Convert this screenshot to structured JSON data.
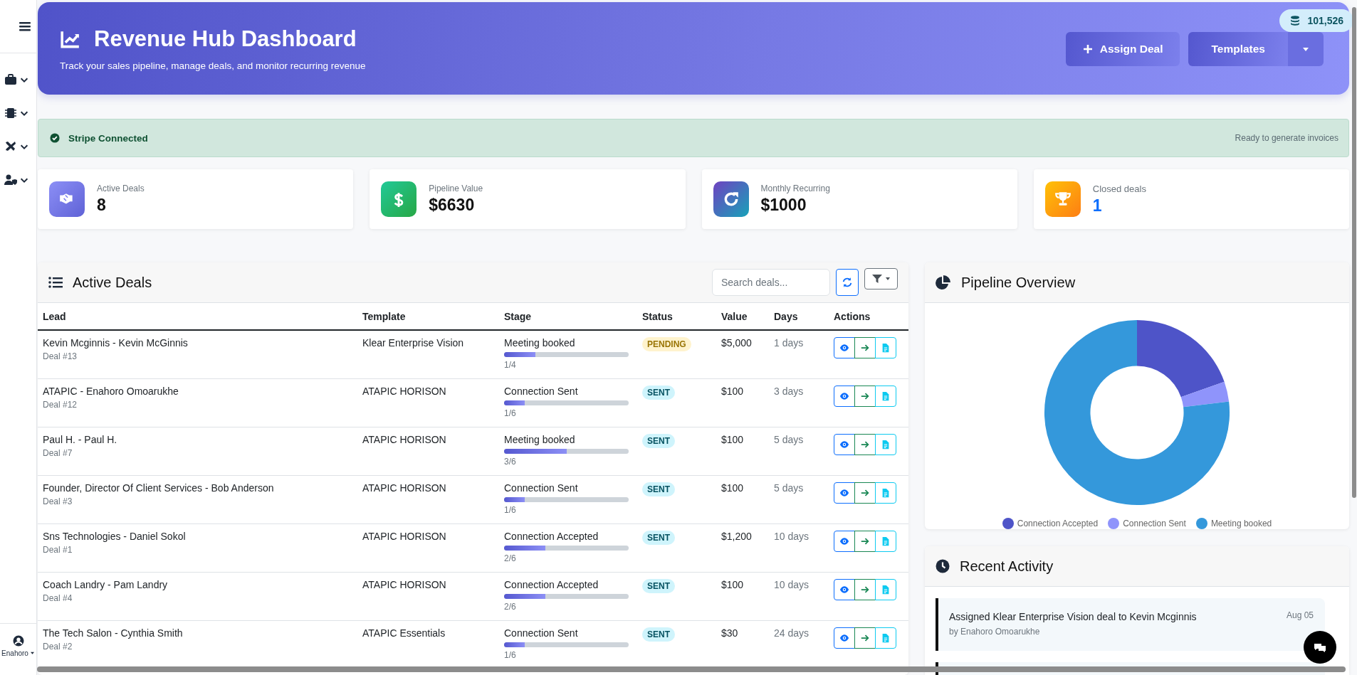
{
  "sidebar": {
    "user": "Enahoro"
  },
  "header": {
    "title": "Revenue Hub Dashboard",
    "subtitle": "Track your sales pipeline, manage deals, and monitor recurring revenue",
    "assign_button": "Assign Deal",
    "templates_button": "Templates",
    "credits": "101,526"
  },
  "alert": {
    "title": "Stripe Connected",
    "note": "Ready to generate invoices"
  },
  "stats": [
    {
      "kind": "deals",
      "label": "Active Deals",
      "value": "8"
    },
    {
      "kind": "pipeline",
      "label": "Pipeline Value",
      "value": "$6630"
    },
    {
      "kind": "recurring",
      "label": "Monthly Recurring",
      "value": "$1000"
    },
    {
      "kind": "closed",
      "label": "Closed deals",
      "value": "1"
    }
  ],
  "deals": {
    "title": "Active Deals",
    "search": {
      "placeholder": "Search deals..."
    },
    "columns": [
      "Lead",
      "Template",
      "Stage",
      "Status",
      "Value",
      "Days",
      "Actions"
    ],
    "rows": [
      {
        "lead": "Kevin Mcginnis - Kevin McGinnis",
        "deal": "Deal #13",
        "template": "Klear Enterprise Vision",
        "stage": "Meeting booked",
        "level": 0.25,
        "step": "1/4",
        "status": {
          "text": "PENDING",
          "kind": "pending"
        },
        "value": "$5,000",
        "days": "1 days"
      },
      {
        "lead": "ATAPIC - Enahoro Omoarukhe",
        "deal": "Deal #12",
        "template": "ATAPIC HORISON",
        "stage": "Connection Sent",
        "level": 0.167,
        "step": "1/6",
        "status": {
          "text": "SENT",
          "kind": "sent"
        },
        "value": "$100",
        "days": "3 days"
      },
      {
        "lead": "Paul H. - Paul H.",
        "deal": "Deal #7",
        "template": "ATAPIC HORISON",
        "stage": "Meeting booked",
        "level": 0.5,
        "step": "3/6",
        "status": {
          "text": "SENT",
          "kind": "sent"
        },
        "value": "$100",
        "days": "5 days"
      },
      {
        "lead": "Founder, Director Of Client Services - Bob Anderson",
        "deal": "Deal #3",
        "template": "ATAPIC HORISON",
        "stage": "Connection Sent",
        "level": 0.167,
        "step": "1/6",
        "status": {
          "text": "SENT",
          "kind": "sent"
        },
        "value": "$100",
        "days": "5 days"
      },
      {
        "lead": "Sns Technologies - Daniel Sokol",
        "deal": "Deal #1",
        "template": "ATAPIC HORISON",
        "stage": "Connection Accepted",
        "level": 0.333,
        "step": "2/6",
        "status": {
          "text": "SENT",
          "kind": "sent"
        },
        "value": "$1,200",
        "days": "10 days"
      },
      {
        "lead": "Coach Landry - Pam Landry",
        "deal": "Deal #4",
        "template": "ATAPIC HORISON",
        "stage": "Connection Accepted",
        "level": 0.333,
        "step": "2/6",
        "status": {
          "text": "SENT",
          "kind": "sent"
        },
        "value": "$100",
        "days": "10 days"
      },
      {
        "lead": "The Tech Salon - Cynthia Smith",
        "deal": "Deal #2",
        "template": "ATAPIC Essentials",
        "stage": "Connection Sent",
        "level": 0.167,
        "step": "1/6",
        "status": {
          "text": "SENT",
          "kind": "sent"
        },
        "value": "$30",
        "days": "24 days"
      }
    ]
  },
  "pipeline": {
    "title": "Pipeline Overview",
    "chart_data": {
      "type": "donut",
      "categories": [
        "Connection Accepted",
        "Connection Sent",
        "Meeting booked"
      ],
      "values": [
        19.6,
        3.5,
        76.9
      ],
      "colors": [
        "#4e54c8",
        "#8f94fb",
        "#3498db"
      ],
      "legend": "bottom"
    }
  },
  "activity": {
    "title": "Recent Activity",
    "items": [
      {
        "text": "Assigned Klear Enterprise Vision deal to Kevin Mcginnis",
        "by": "by Enahoro Omoarukhe",
        "date": "Aug 05"
      }
    ]
  }
}
